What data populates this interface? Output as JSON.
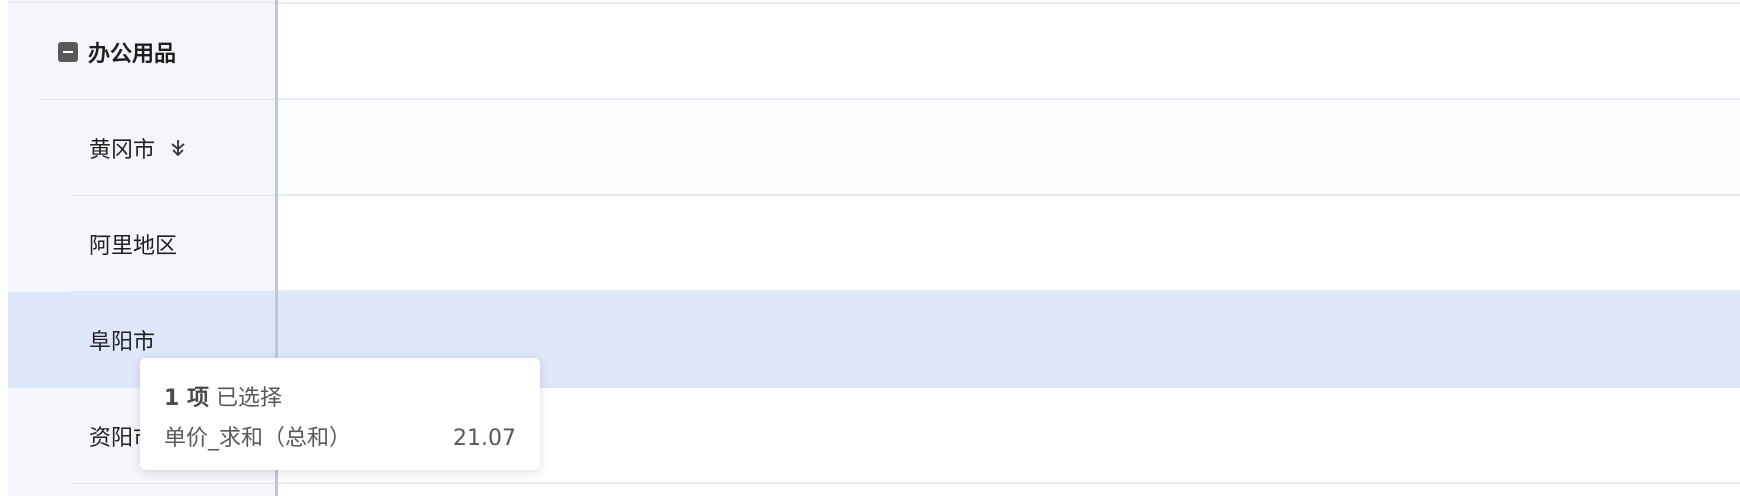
{
  "pivot": {
    "group": {
      "label": "办公用品",
      "icon": "collapse-minus-icon"
    },
    "rows": [
      {
        "label": "黄冈市",
        "has_drill_icon": true
      },
      {
        "label": "阿里地区"
      },
      {
        "label": "阜阳市",
        "selected": true
      },
      {
        "label": "资阳市"
      }
    ]
  },
  "tooltip": {
    "count": "1 项",
    "selected_text": "已选择",
    "metric_label": "单价_求和（总和）",
    "metric_value": "21.07"
  },
  "colors": {
    "selected_row": "#dfe7fa",
    "header_bg": "#f5f6fb",
    "divider": "#bfc7d9"
  }
}
